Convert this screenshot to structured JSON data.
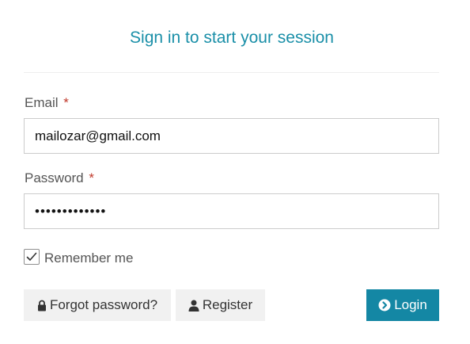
{
  "header": {
    "title": "Sign in to start your session"
  },
  "form": {
    "email": {
      "label": "Email",
      "required_mark": "*",
      "value": "mailozar@gmail.com"
    },
    "password": {
      "label": "Password",
      "required_mark": "*",
      "value": "•••••••••••••"
    },
    "remember": {
      "label": "Remember me",
      "checked": true
    }
  },
  "actions": {
    "forgot_label": "Forgot password?",
    "register_label": "Register",
    "login_label": "Login"
  },
  "icons": {
    "forgot": "lock-icon",
    "register": "user-icon",
    "login": "chevron-circle-right-icon",
    "remember": "check-icon"
  },
  "colors": {
    "title": "#1a8fa8",
    "primary_button": "#1487a4",
    "secondary_button": "#f1f1f1",
    "required": "#c0392b"
  }
}
